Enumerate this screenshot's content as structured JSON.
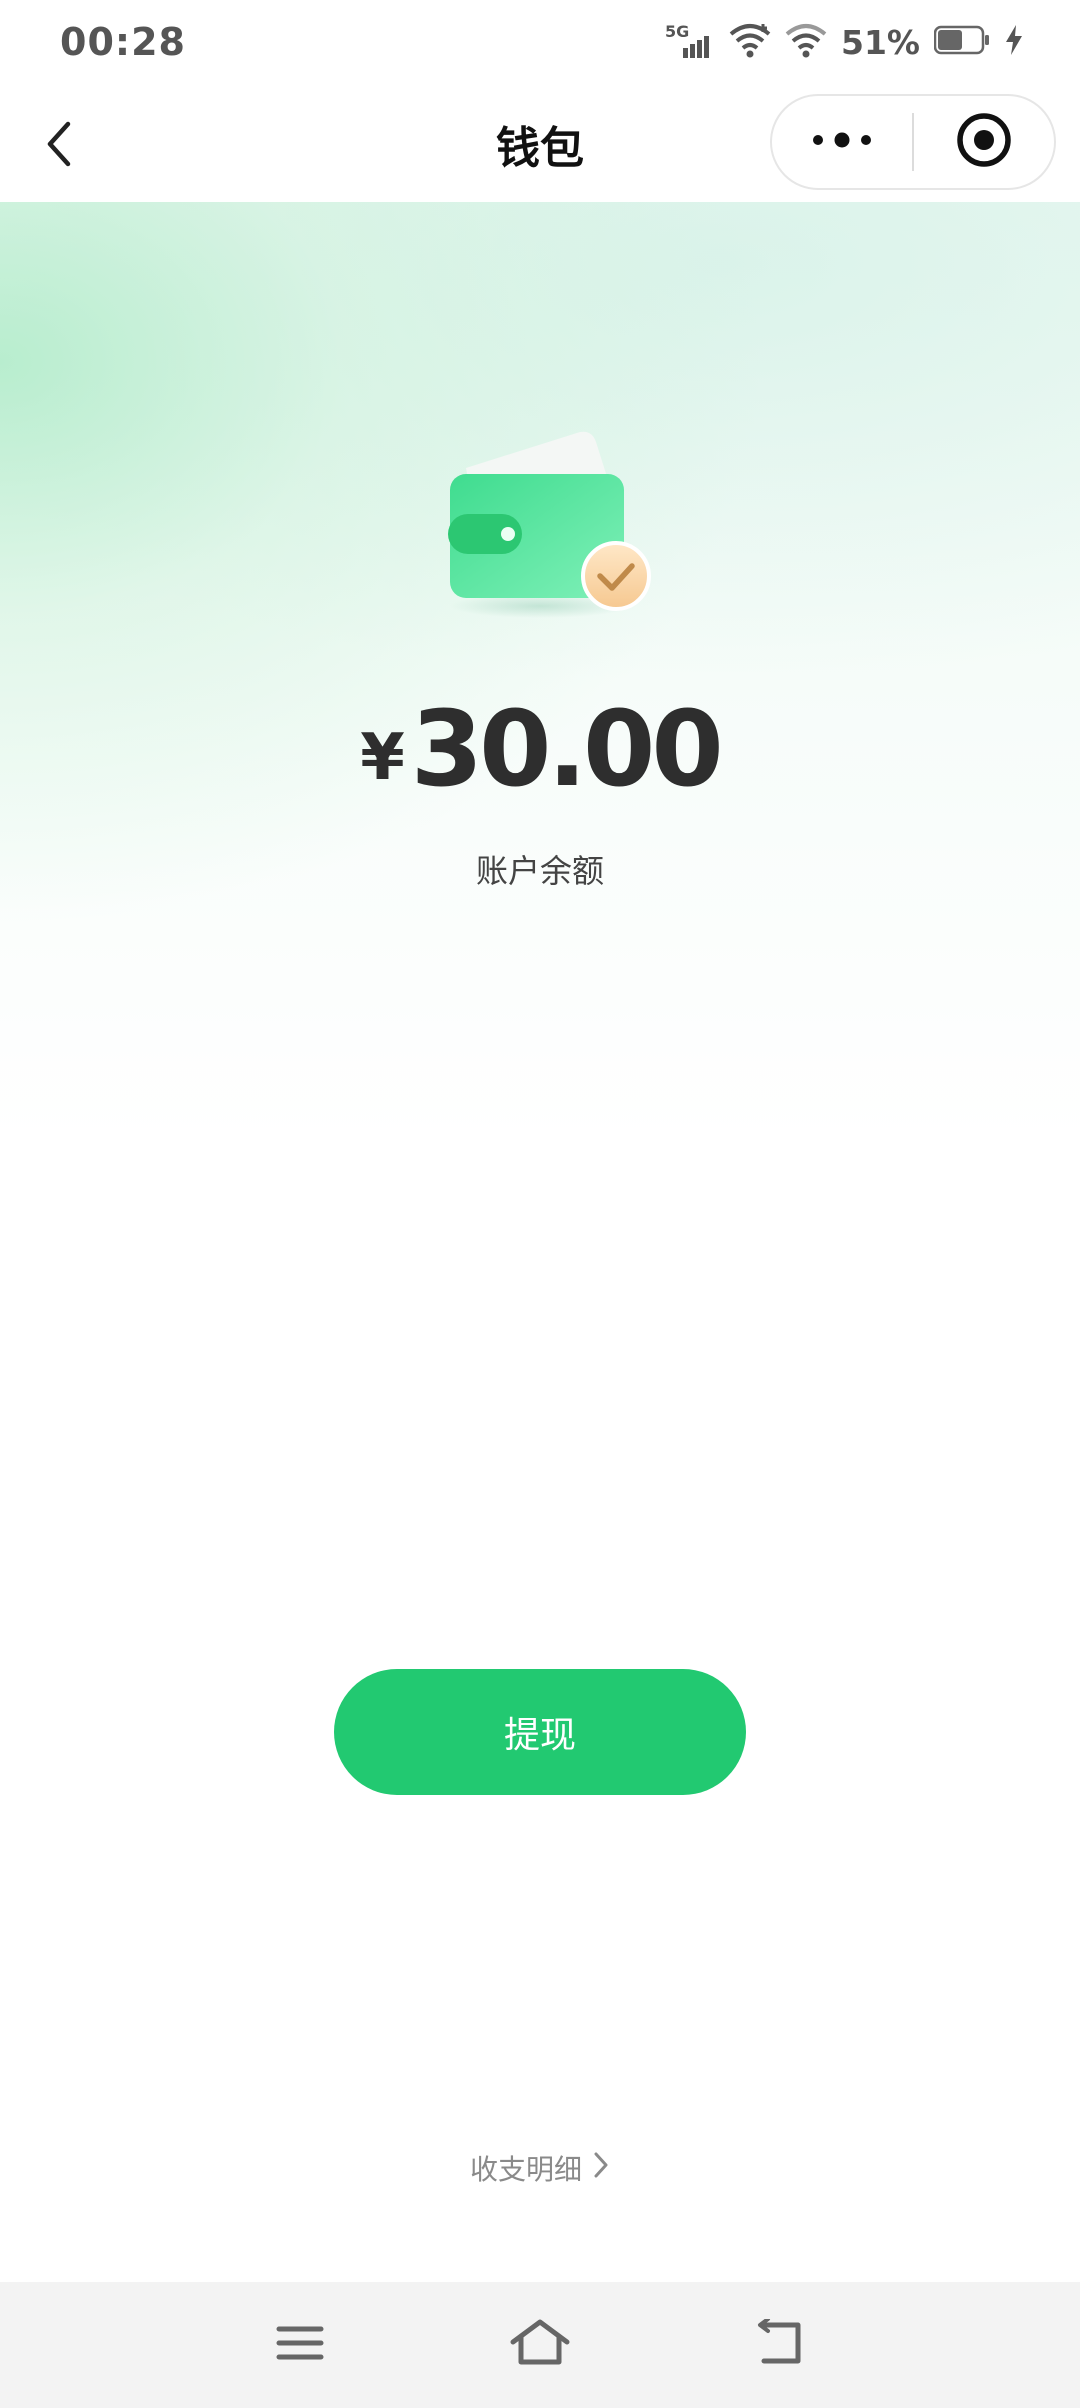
{
  "status_bar": {
    "time": "00:28",
    "network": "5G",
    "battery_percent": "51%",
    "icons": [
      "5g-signal-icon",
      "wifi-icon",
      "wifi-icon",
      "battery-icon",
      "charging-bolt-icon"
    ]
  },
  "nav": {
    "title": "钱包",
    "back_icon": "chevron-left-icon",
    "more_icon": "more-dots-icon",
    "close_icon": "target-circle-icon"
  },
  "wallet": {
    "currency_symbol": "¥",
    "balance": "30.00",
    "balance_label": "账户余额",
    "illustration_icon": "wallet-check-icon"
  },
  "actions": {
    "withdraw_label": "提现"
  },
  "footer": {
    "details_label": "收支明细",
    "details_icon": "chevron-right-icon"
  },
  "system_nav": {
    "icons": [
      "menu-icon",
      "home-icon",
      "back-icon"
    ]
  },
  "colors": {
    "accent": "#22c971",
    "title": "#111111",
    "text_secondary": "#8a8a8a"
  }
}
